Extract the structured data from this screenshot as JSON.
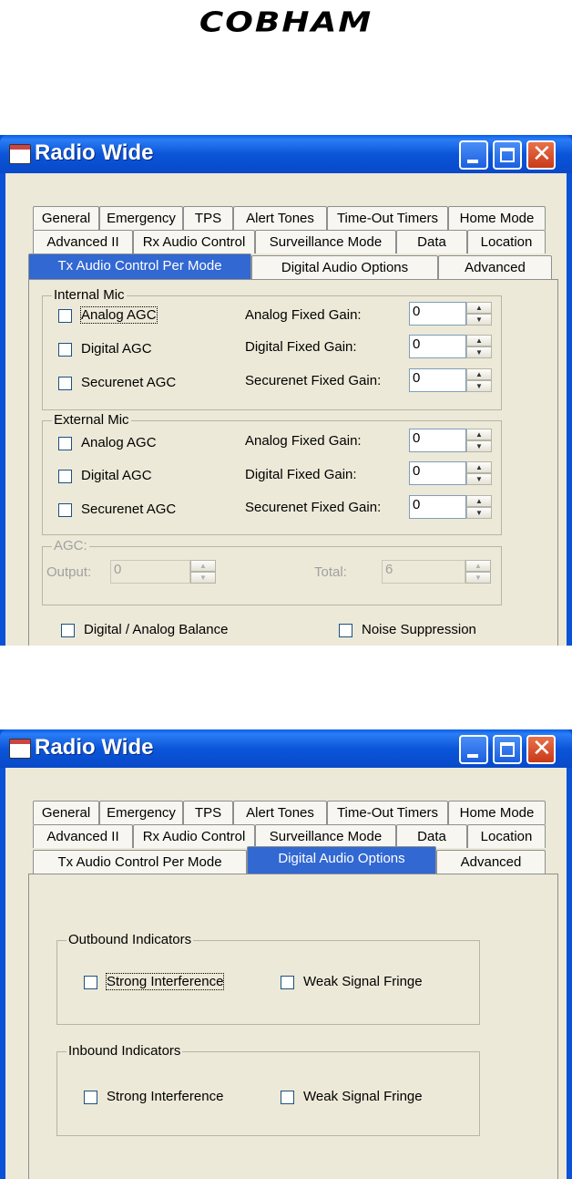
{
  "brand": {
    "logo_text": "COBHAM"
  },
  "windows": [
    {
      "title": "Radio Wide",
      "tabs_row1": [
        "General",
        "Emergency",
        "TPS",
        "Alert Tones",
        "Time-Out Timers",
        "Home Mode"
      ],
      "tabs_row2": [
        "Advanced II",
        "Rx Audio Control",
        "Surveillance Mode",
        "Data",
        "Location"
      ],
      "tabs_row3": [
        "Tx Audio Control Per Mode",
        "Digital Audio Options",
        "Advanced"
      ],
      "active_tab": "Tx Audio Control Per Mode",
      "internal_mic": {
        "legend": "Internal Mic",
        "rows": [
          {
            "checkbox": "Analog AGC",
            "gain_label": "Analog Fixed Gain:",
            "value": "0"
          },
          {
            "checkbox": "Digital AGC",
            "gain_label": "Digital Fixed Gain:",
            "value": "0"
          },
          {
            "checkbox": "Securenet AGC",
            "gain_label": "Securenet Fixed Gain:",
            "value": "0"
          }
        ]
      },
      "external_mic": {
        "legend": "External Mic",
        "rows": [
          {
            "checkbox": "Analog AGC",
            "gain_label": "Analog Fixed Gain:",
            "value": "0"
          },
          {
            "checkbox": "Digital AGC",
            "gain_label": "Digital Fixed Gain:",
            "value": "0"
          },
          {
            "checkbox": "Securenet AGC",
            "gain_label": "Securenet Fixed Gain:",
            "value": "0"
          }
        ]
      },
      "agc": {
        "legend": "AGC:",
        "output_label": "Output:",
        "output_value": "0",
        "total_label": "Total:",
        "total_value": "6"
      },
      "bottom_checks": [
        "Digital / Analog Balance",
        "Noise Suppression"
      ]
    },
    {
      "title": "Radio Wide",
      "tabs_row1": [
        "General",
        "Emergency",
        "TPS",
        "Alert Tones",
        "Time-Out Timers",
        "Home Mode"
      ],
      "tabs_row2": [
        "Advanced II",
        "Rx Audio Control",
        "Surveillance Mode",
        "Data",
        "Location"
      ],
      "tabs_row3": [
        "Tx Audio Control Per Mode",
        "Digital Audio Options",
        "Advanced"
      ],
      "active_tab": "Digital Audio Options",
      "outbound": {
        "legend": "Outbound Indicators",
        "checks": [
          "Strong Interference",
          "Weak Signal Fringe"
        ]
      },
      "inbound": {
        "legend": "Inbound Indicators",
        "checks": [
          "Strong Interference",
          "Weak Signal Fringe"
        ]
      }
    }
  ]
}
